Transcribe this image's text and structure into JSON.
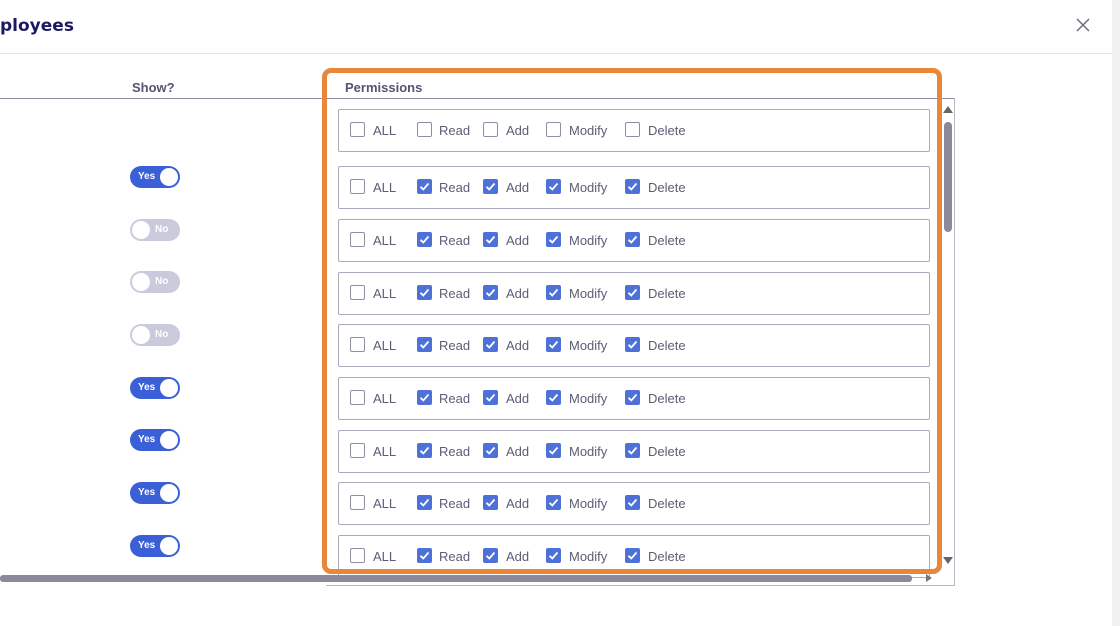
{
  "dialog": {
    "title": "ployees",
    "close_icon": "close-icon"
  },
  "columns": {
    "show": "Show?",
    "permissions": "Permissions"
  },
  "permission_labels": {
    "all": "ALL",
    "read": "Read",
    "add": "Add",
    "modify": "Modify",
    "delete": "Delete"
  },
  "rows": [
    {
      "show": null,
      "all": false,
      "read": false,
      "add": false,
      "modify": false,
      "delete": false
    },
    {
      "show": "Yes",
      "all": false,
      "read": true,
      "add": true,
      "modify": true,
      "delete": true
    },
    {
      "show": "No",
      "all": false,
      "read": true,
      "add": true,
      "modify": true,
      "delete": true
    },
    {
      "show": "No",
      "all": false,
      "read": true,
      "add": true,
      "modify": true,
      "delete": true
    },
    {
      "show": "No",
      "all": false,
      "read": true,
      "add": true,
      "modify": true,
      "delete": true
    },
    {
      "show": "Yes",
      "all": false,
      "read": true,
      "add": true,
      "modify": true,
      "delete": true
    },
    {
      "show": "Yes",
      "all": false,
      "read": true,
      "add": true,
      "modify": true,
      "delete": true
    },
    {
      "show": "Yes",
      "all": false,
      "read": true,
      "add": true,
      "modify": true,
      "delete": true
    },
    {
      "show": "Yes",
      "all": false,
      "read": true,
      "add": true,
      "modify": true,
      "delete": true
    }
  ],
  "colors": {
    "accent": "#3b5fd6",
    "checkbox_checked": "#4d70d9",
    "toggle_off": "#c9cadc",
    "highlight": "#e8873a",
    "title": "#1c1a5e"
  }
}
